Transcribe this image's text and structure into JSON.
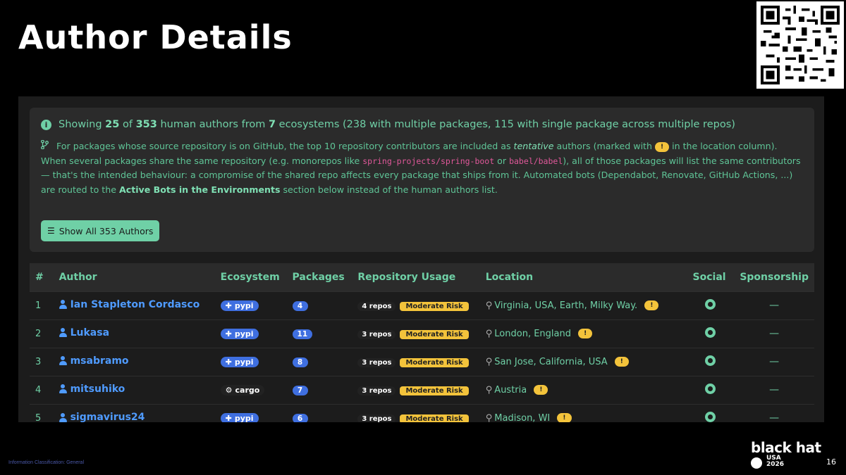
{
  "slide": {
    "title": "Author Details",
    "page_number": "16",
    "footer_classification": "Information Classification: General",
    "logo_main": "black hat",
    "logo_sub1": "USA",
    "logo_sub2": "2026"
  },
  "info": {
    "head_showing": "Showing",
    "shown_count": "25",
    "head_of": "of",
    "total_count": "353",
    "head_from": "human authors from",
    "ecosystem_count": "7",
    "head_rest": "ecosystems (238 with multiple packages, 115 with single package across multiple repos)",
    "body_1": "For packages whose source repository is on GitHub, the top 10 repository contributors are included as",
    "body_tentative": "tentative",
    "body_2": "authors (marked with",
    "body_chip": "!",
    "body_3": "in the location column). When several packages share the same repository (e.g. monorepos like",
    "code_1": "spring-projects/spring-boot",
    "body_or": "or",
    "code_2": "babel/babel",
    "body_4": "), all of those packages will list the same contributors — that's the intended behaviour: a compromise of the shared repo affects every package that ships from it. Automated bots (Dependabot, Renovate, GitHub Actions, ...) are routed to the",
    "body_bold": "Active Bots in the Environments",
    "body_5": "section below instead of the human authors list.",
    "show_all_label": "Show All 353 Authors"
  },
  "table": {
    "headers": [
      "#",
      "Author",
      "Ecosystem",
      "Packages",
      "Repository Usage",
      "Location",
      "Social",
      "Sponsorship"
    ],
    "rows": [
      {
        "n": "1",
        "author": "Ian Stapleton Cordasco",
        "eco": "pypi",
        "pkgs": "4",
        "repos": "4 repos",
        "risk": "Moderate Risk",
        "location": "Virginia, USA, Earth, Milky Way.",
        "flag": "!",
        "sponsor": "—"
      },
      {
        "n": "2",
        "author": "Lukasa",
        "eco": "pypi",
        "pkgs": "11",
        "repos": "3 repos",
        "risk": "Moderate Risk",
        "location": "London, England",
        "flag": "!",
        "sponsor": "—"
      },
      {
        "n": "3",
        "author": "msabramo",
        "eco": "pypi",
        "pkgs": "8",
        "repos": "3 repos",
        "risk": "Moderate Risk",
        "location": "San Jose, California, USA",
        "flag": "!",
        "sponsor": "—"
      },
      {
        "n": "4",
        "author": "mitsuhiko",
        "eco": "cargo",
        "pkgs": "7",
        "repos": "3 repos",
        "risk": "Moderate Risk",
        "location": "Austria",
        "flag": "!",
        "sponsor": "—"
      },
      {
        "n": "5",
        "author": "sigmavirus24",
        "eco": "pypi",
        "pkgs": "6",
        "repos": "3 repos",
        "risk": "Moderate Risk",
        "location": "Madison, WI",
        "flag": "!",
        "sponsor": "—"
      }
    ]
  },
  "icons": {
    "info": "info-circle-icon",
    "branch": "code-branch-icon",
    "list": "list-icon",
    "user": "user-icon",
    "pypi": "python-icon",
    "cargo": "gear-icon",
    "pin": "map-pin-icon",
    "github": "github-icon",
    "qr": "qr-code"
  },
  "colors": {
    "accent": "#6fd0a6",
    "link": "#4f9bff",
    "badge_blue": "#3f6fe0",
    "warning": "#f3c33b",
    "code": "#e0589a"
  }
}
